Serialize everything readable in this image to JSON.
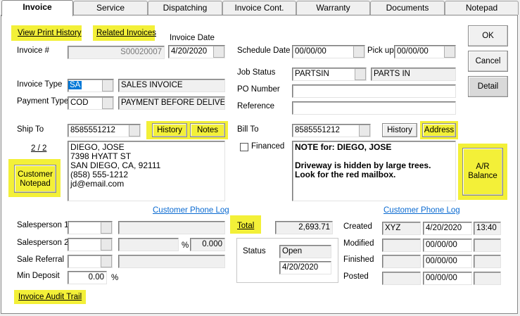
{
  "tabs": [
    {
      "label": "Invoice",
      "active": true
    },
    {
      "label": "Service"
    },
    {
      "label": "Dispatching"
    },
    {
      "label": "Invoice Cont."
    },
    {
      "label": "Warranty"
    },
    {
      "label": "Documents"
    },
    {
      "label": "Notepad"
    }
  ],
  "links": {
    "view_print_history": "View Print History",
    "related_invoices": "Related Invoices",
    "customer_phone_log_left": "Customer Phone Log",
    "customer_phone_log_right": "Customer Phone Log",
    "total": "Total",
    "invoice_audit_trail": "Invoice Audit Trail"
  },
  "invoice": {
    "number_label": "Invoice #",
    "number": "S00020007",
    "date_label": "Invoice Date",
    "date": "4/20/2020",
    "type_label": "Invoice Type",
    "type_code": "SA",
    "type_desc": "SALES INVOICE",
    "payment_label": "Payment Type",
    "payment_code": "COD",
    "payment_desc": "PAYMENT BEFORE DELIVER"
  },
  "schedule": {
    "date_label": "Schedule Date",
    "date": "00/00/00",
    "pickup_label": "Pick up",
    "pickup": "00/00/00",
    "job_status_label": "Job Status",
    "job_status_code": "PARTSIN",
    "job_status_desc": "PARTS IN",
    "po_label": "PO Number",
    "po": "",
    "reference_label": "Reference",
    "reference": ""
  },
  "ship_to": {
    "label": "Ship To",
    "phone": "8585551212",
    "history_button": "History",
    "notes_button": "Notes",
    "page": "2 / 2",
    "address_lines": [
      "DIEGO, JOSE",
      "7398 HYATT ST",
      "SAN DIEGO,  CA,  92111",
      "(858) 555-1212",
      "jd@email.com"
    ],
    "customer_notepad_button": [
      "Customer",
      "Notepad"
    ]
  },
  "bill_to": {
    "label": "Bill To",
    "phone": "8585551212",
    "history_button": "History",
    "address_button": "Address",
    "financed_label": "Financed",
    "note_lines": [
      "NOTE for:  DIEGO,  JOSE",
      "",
      "Driveway is hidden by large trees.",
      "Look for the red mailbox."
    ],
    "ar_balance_button": [
      "A/R",
      "Balance"
    ]
  },
  "buttons": {
    "ok": "OK",
    "cancel": "Cancel",
    "detail": "Detail"
  },
  "sales": {
    "salesperson1_label": "Salesperson 1",
    "salesperson2_label": "Salesperson 2",
    "percent_sign": "%",
    "salesperson2_pct": "0.000",
    "referral_label": "Sale Referral",
    "min_deposit_label": "Min Deposit",
    "min_deposit": "0.00",
    "min_deposit_pct": "%"
  },
  "totals": {
    "total_value": "2,693.71",
    "status_label": "Status",
    "status_value": "Open",
    "status_date": "4/20/2020"
  },
  "audit": {
    "created_label": "Created",
    "created_user": "XYZ",
    "created_date": "4/20/2020",
    "created_time": "13:40",
    "modified_label": "Modified",
    "modified_date": "00/00/00",
    "finished_label": "Finished",
    "finished_date": "00/00/00",
    "posted_label": "Posted",
    "posted_date": "00/00/00"
  },
  "colors": {
    "highlight": "#f3f038",
    "link_blue": "#0a6ad1",
    "selection": "#0078d7"
  }
}
